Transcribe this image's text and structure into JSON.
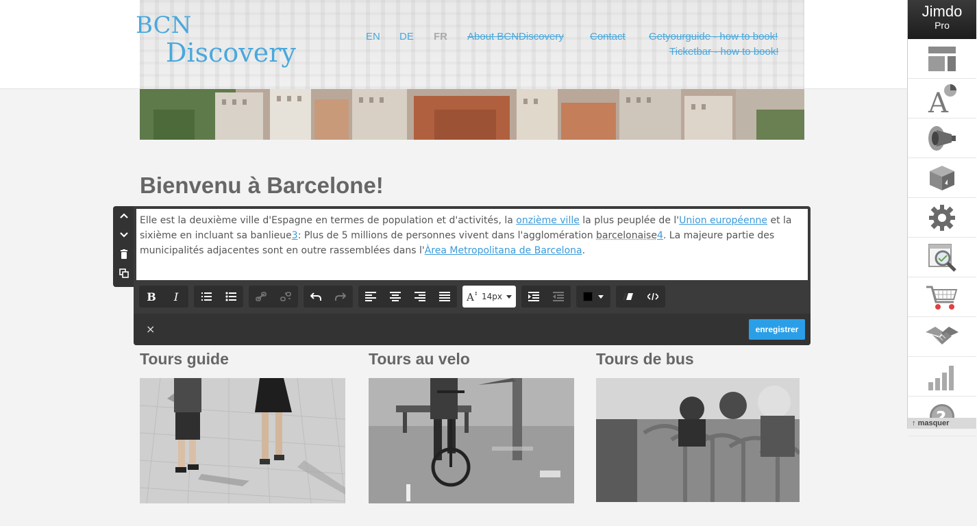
{
  "logo": {
    "line1": "BCN",
    "line2": "Discovery"
  },
  "languages": [
    {
      "label": "EN"
    },
    {
      "label": "DE"
    },
    {
      "label": "FR"
    }
  ],
  "nav": {
    "items": [
      {
        "label": "About BCNDiscovery"
      },
      {
        "label": "Contact"
      },
      {
        "label": "Getyourguide - how to book!"
      },
      {
        "label": "Ticketbar - how to book!"
      }
    ]
  },
  "page": {
    "title": "Bienvenu à Barcelone!"
  },
  "editor": {
    "p1": "Elle est la deuxième ville d'Espagne en termes de population et d'activités, la ",
    "link1": "onzième ville",
    "p2": " la plus peuplée de l'",
    "link2": "Union européenne",
    "p3": " et la sixième en incluant sa banlieue",
    "ref3": "3",
    "p4": ": Plus de 5 millions de personnes vivent dans l'agglomération ",
    "word": "barcelonaise",
    "ref4": "4",
    "p5": ". La majeure partie des municipalités adjacentes sont en outre rassemblées dans l'",
    "link3": "Àrea Metropolitana de Barcelona",
    "p6": ".",
    "font_size": "14px",
    "bold_label": "B",
    "italic_label": "I",
    "close_label": "×",
    "save_label": "enregistrer"
  },
  "tours": [
    {
      "title": "Tours guide"
    },
    {
      "title": "Tours au velo"
    },
    {
      "title": "Tours de bus"
    }
  ],
  "jimdo": {
    "brand": "Jimdo",
    "plan": "Pro",
    "hide_label": "masquer"
  },
  "colors": {
    "accent": "#4aa8dc",
    "save": "#2a9fe8",
    "toolbar": "#3b3b3b"
  }
}
